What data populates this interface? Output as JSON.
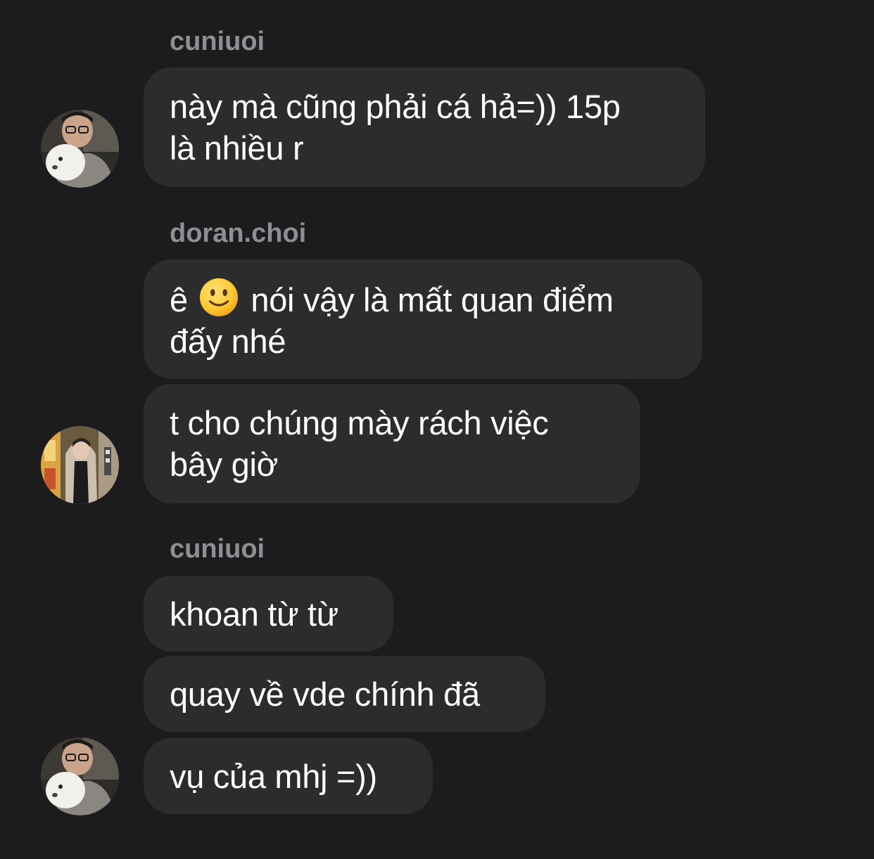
{
  "chat": {
    "group1": {
      "sender": "cuniuoi",
      "msg1": "này mà cũng phải cá hả=)) 15p\nlà nhiều r"
    },
    "group2": {
      "sender": "doran.choi",
      "msg1_before": "ê",
      "msg1_emoji": "slightly-smiling-face-emoji",
      "msg1_after": "nói vậy là mất quan điểm\nđấy nhé",
      "msg2": "t cho chúng mày rách việc\nbây giờ"
    },
    "group3": {
      "sender": "cuniuoi",
      "msg1": "khoan từ từ",
      "msg2": "quay về vde chính đã",
      "msg3": "vụ của mhj =))"
    }
  },
  "colors": {
    "background": "#1c1c1e",
    "bubble": "#2c2c2e",
    "sender_text": "#8e8e93",
    "message_text": "#ffffff"
  }
}
